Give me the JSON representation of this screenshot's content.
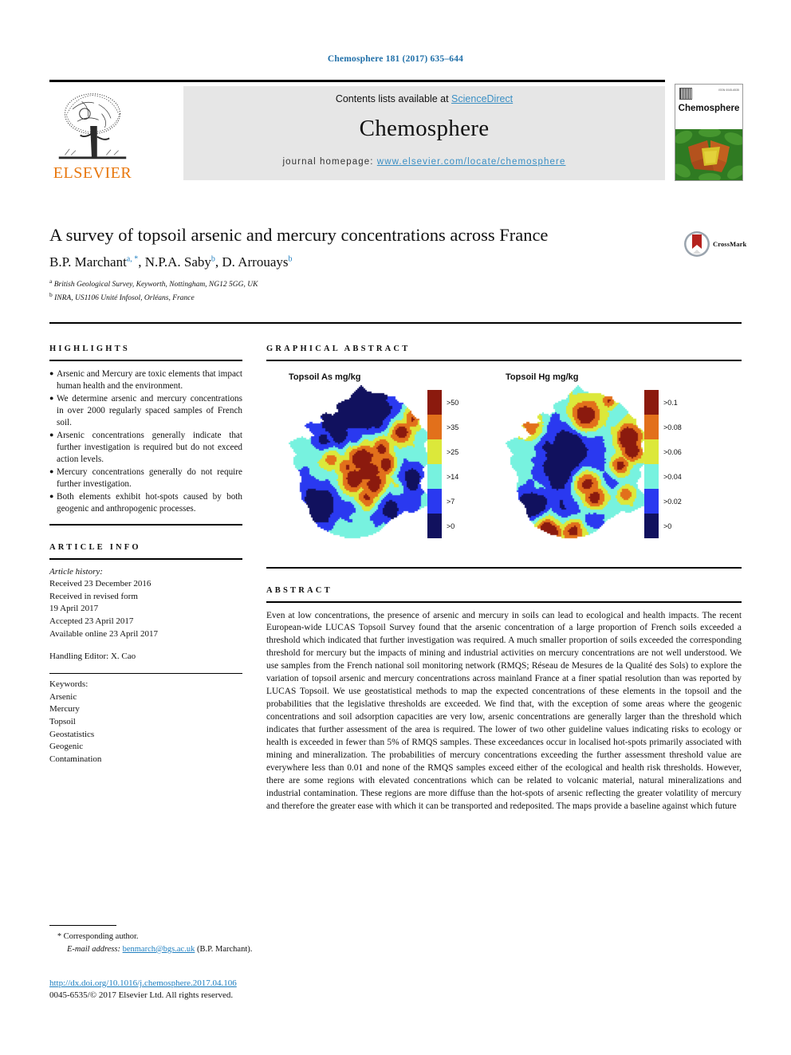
{
  "running_head": "Chemosphere 181 (2017) 635–644",
  "masthead": {
    "contents_prefix": "Contents lists available at ",
    "sciencedirect": "ScienceDirect",
    "journal_name": "Chemosphere",
    "homepage_prefix": "journal homepage: ",
    "homepage_url": "www.elsevier.com/locate/chemosphere",
    "publisher": "ELSEVIER",
    "cover_title": "Chemosphere",
    "cover_corner_text": "ISSN 0045-6535"
  },
  "article": {
    "title": "A survey of topsoil arsenic and mercury concentrations across France",
    "authors": "B.P. Marchant",
    "author_list": [
      {
        "name": "B.P. Marchant",
        "marks": "a, *"
      },
      {
        "name": "N.P.A. Saby",
        "marks": "b"
      },
      {
        "name": "D. Arrouays",
        "marks": "b"
      }
    ],
    "affiliations": [
      {
        "mark": "a",
        "text": "British Geological Survey, Keyworth, Nottingham, NG12 5GG, UK"
      },
      {
        "mark": "b",
        "text": "INRA, US1106 Unité Infosol, Orléans, France"
      }
    ],
    "crossmark_label": "CrossMark"
  },
  "highlights": {
    "heading": "HIGHLIGHTS",
    "items": [
      "Arsenic and Mercury are toxic elements that impact human health and the environment.",
      "We determine arsenic and mercury concentrations in over 2000 regularly spaced samples of French soil.",
      "Arsenic concentrations generally indicate that further investigation is required but do not exceed action levels.",
      "Mercury concentrations generally do not require further investigation.",
      "Both elements exhibit hot-spots caused by both geogenic and anthropogenic processes."
    ],
    "bullet": "●"
  },
  "article_info": {
    "heading": "ARTICLE INFO",
    "history_label": "Article history:",
    "history_lines": [
      "Received 23 December 2016",
      "Received in revised form",
      "19 April 2017",
      "Accepted 23 April 2017",
      "Available online 23 April 2017"
    ],
    "handling_editor": "Handling Editor: X. Cao",
    "keywords_label": "Keywords:",
    "keywords": [
      "Arsenic",
      "Mercury",
      "Topsoil",
      "Geostatistics",
      "Geogenic",
      "Contamination"
    ]
  },
  "graphical_abstract": {
    "heading": "GRAPHICAL ABSTRACT"
  },
  "chart_data": [
    {
      "type": "heatmap",
      "title": "Topsoil As mg/kg",
      "xlabel": "",
      "ylabel": "",
      "legend_position": "right",
      "grid": false,
      "element": "As",
      "unit": "mg/kg",
      "legend_entries": [
        {
          "label": ">50",
          "color": "#8B1A0E",
          "min": 50
        },
        {
          "label": ">35",
          "color": "#E2701B",
          "min": 35
        },
        {
          "label": ">25",
          "color": "#DCE83A",
          "min": 25
        },
        {
          "label": ">14",
          "color": "#77F2DF",
          "min": 14
        },
        {
          "label": ">7",
          "color": "#2A39F0",
          "min": 7
        },
        {
          "label": ">0",
          "color": "#11115E",
          "min": 0
        }
      ]
    },
    {
      "type": "heatmap",
      "title": "Topsoil Hg mg/kg",
      "xlabel": "",
      "ylabel": "",
      "legend_position": "right",
      "grid": false,
      "element": "Hg",
      "unit": "mg/kg",
      "legend_entries": [
        {
          "label": ">0.1",
          "color": "#8B1A0E",
          "min": 0.1
        },
        {
          "label": ">0.08",
          "color": "#E2701B",
          "min": 0.08
        },
        {
          "label": ">0.06",
          "color": "#DCE83A",
          "min": 0.06
        },
        {
          "label": ">0.04",
          "color": "#77F2DF",
          "min": 0.04
        },
        {
          "label": ">0.02",
          "color": "#2A39F0",
          "min": 0.02
        },
        {
          "label": ">0",
          "color": "#11115E",
          "min": 0
        }
      ]
    }
  ],
  "abstract": {
    "heading": "ABSTRACT",
    "text": "Even at low concentrations, the presence of arsenic and mercury in soils can lead to ecological and health impacts. The recent European-wide LUCAS Topsoil Survey found that the arsenic concentration of a large proportion of French soils exceeded a threshold which indicated that further investigation was required. A much smaller proportion of soils exceeded the corresponding threshold for mercury but the impacts of mining and industrial activities on mercury concentrations are not well understood. We use samples from the French national soil monitoring network (RMQS; Réseau de Mesures de la Qualité des Sols) to explore the variation of topsoil arsenic and mercury concentrations across mainland France at a finer spatial resolution than was reported by LUCAS Topsoil. We use geostatistical methods to map the expected concentrations of these elements in the topsoil and the probabilities that the legislative thresholds are exceeded. We find that, with the exception of some areas where the geogenic concentrations and soil adsorption capacities are very low, arsenic concentrations are generally larger than the threshold which indicates that further assessment of the area is required. The lower of two other guideline values indicating risks to ecology or health is exceeded in fewer than 5% of RMQS samples. These exceedances occur in localised hot-spots primarily associated with mining and mineralization. The probabilities of mercury concentrations exceeding the further assessment threshold value are everywhere less than 0.01 and none of the RMQS samples exceed either of the ecological and health risk thresholds. However, there are some regions with elevated concentrations which can be related to volcanic material, natural mineralizations and industrial contamination. These regions are more diffuse than the hot-spots of arsenic reflecting the greater volatility of mercury and therefore the greater ease with which it can be transported and redeposited. The maps provide a baseline against which future"
  },
  "footnote": {
    "star": "*",
    "corresponding": "Corresponding author.",
    "email_label": "E-mail address:",
    "email": "benmarch@bgs.ac.uk",
    "email_owner": "(B.P. Marchant)."
  },
  "footer": {
    "doi": "http://dx.doi.org/10.1016/j.chemosphere.2017.04.106",
    "copyright": "0045-6535/© 2017 Elsevier Ltd. All rights reserved."
  },
  "colors": {
    "link": "#1f7fc0",
    "elsevier_orange": "#E8770D",
    "band_gray": "#e6e6e6"
  }
}
